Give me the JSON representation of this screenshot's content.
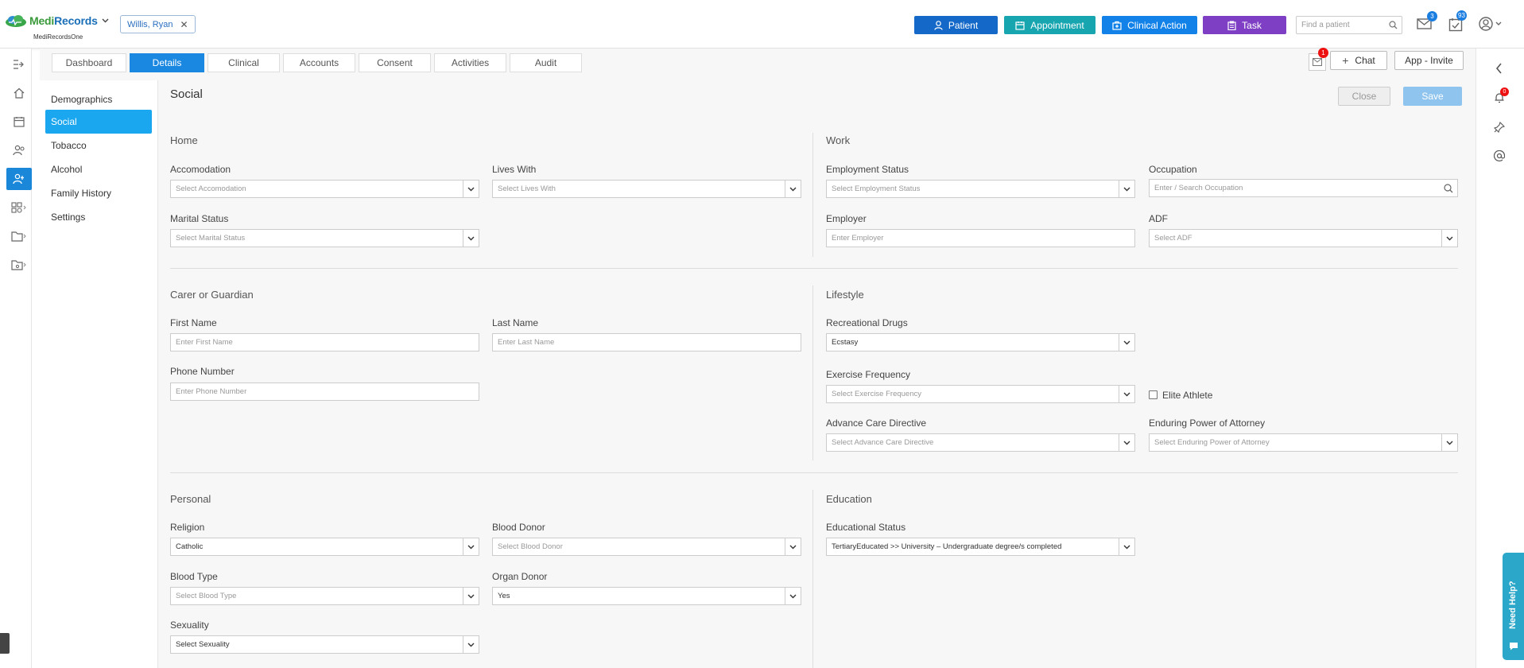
{
  "header": {
    "logo_text_a": "Medi",
    "logo_text_b": "Records",
    "logo_sub": "MediRecordsOne",
    "patient_chip": "Willis, Ryan",
    "buttons": {
      "patient": "Patient",
      "appointment": "Appointment",
      "clinical_action": "Clinical Action",
      "task": "Task"
    },
    "search_placeholder": "Find a patient",
    "mail_count": "3",
    "tasks_count": "93",
    "colors": {
      "patient": "#1468c8",
      "appointment": "#17a5b0",
      "clinical_action": "#1382e8",
      "task": "#7e3fc4"
    }
  },
  "tabs": [
    "Dashboard",
    "Details",
    "Clinical",
    "Accounts",
    "Consent",
    "Activities",
    "Audit"
  ],
  "active_tab": "Details",
  "top_actions": {
    "mail_badge": "1",
    "chat": "Chat",
    "invite": "App - Invite"
  },
  "subnav": [
    "Demographics",
    "Social",
    "Tobacco",
    "Alcohol",
    "Family History",
    "Settings"
  ],
  "active_subnav": "Social",
  "page": {
    "title": "Social",
    "close": "Close",
    "save": "Save"
  },
  "home": {
    "title": "Home",
    "accomodation": {
      "label": "Accomodation",
      "value": "Select Accomodation"
    },
    "lives_with": {
      "label": "Lives With",
      "value": "Select Lives With"
    },
    "marital_status": {
      "label": "Marital Status",
      "value": "Select Marital Status"
    }
  },
  "work": {
    "title": "Work",
    "employment_status": {
      "label": "Employment Status",
      "value": "Select Employment Status"
    },
    "occupation": {
      "label": "Occupation",
      "value": "Enter / Search Occupation"
    },
    "employer": {
      "label": "Employer",
      "value": "Enter Employer"
    },
    "adf": {
      "label": "ADF",
      "value": "Select ADF"
    }
  },
  "carer": {
    "title": "Carer or Guardian",
    "first_name": {
      "label": "First Name",
      "value": "Enter First Name"
    },
    "last_name": {
      "label": "Last Name",
      "value": "Enter Last Name"
    },
    "phone": {
      "label": "Phone Number",
      "value": "Enter Phone Number"
    }
  },
  "lifestyle": {
    "title": "Lifestyle",
    "recreational_drugs": {
      "label": "Recreational Drugs",
      "value": "Ecstasy"
    },
    "exercise_frequency": {
      "label": "Exercise Frequency",
      "value": "Select Exercise Frequency"
    },
    "elite_athlete": "Elite Athlete",
    "advance_care": {
      "label": "Advance Care Directive",
      "value": "Select Advance Care Directive"
    },
    "enduring_poa": {
      "label": "Enduring Power of Attorney",
      "value": "Select Enduring Power of Attorney"
    }
  },
  "personal": {
    "title": "Personal",
    "religion": {
      "label": "Religion",
      "value": "Catholic"
    },
    "blood_donor": {
      "label": "Blood Donor",
      "value": "Select Blood Donor"
    },
    "blood_type": {
      "label": "Blood Type",
      "value": "Select Blood Type"
    },
    "organ_donor": {
      "label": "Organ Donor",
      "value": "Yes"
    },
    "sexuality": {
      "label": "Sexuality",
      "value": "Select Sexuality"
    }
  },
  "education": {
    "title": "Education",
    "educational_status": {
      "label": "Educational Status",
      "value": "TertiaryEducated >> University – Undergraduate degree/s completed"
    }
  },
  "right_rail": {
    "notif_badge": "0",
    "need_help": "Need Help?"
  }
}
